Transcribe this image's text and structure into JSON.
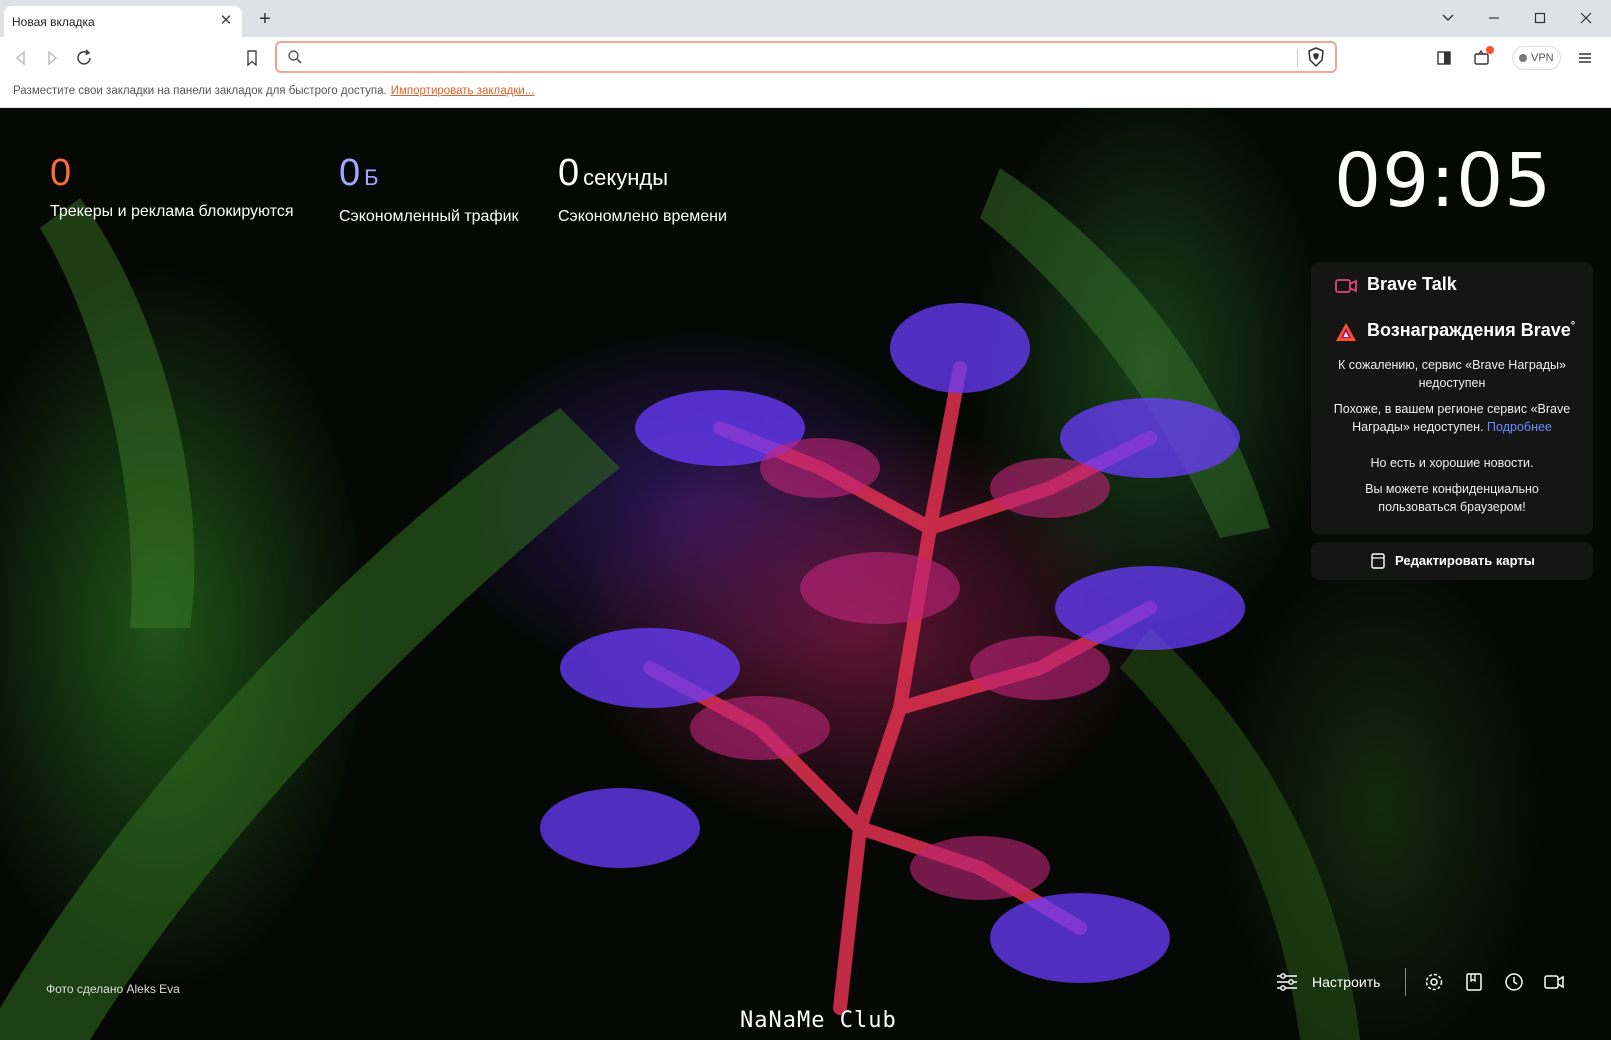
{
  "tab": {
    "title": "Новая вкладка",
    "close": "✕",
    "new_tab": "+"
  },
  "omnibox": {
    "value": "",
    "placeholder": ""
  },
  "toolbar": {
    "vpn_label": "VPN"
  },
  "bookmarks_bar": {
    "text": "Разместите свои закладки на панели закладок для быстрого доступа.",
    "import_link": "Импортировать закладки..."
  },
  "stats": [
    {
      "value": "0",
      "unit": "",
      "label": "Трекеры и реклама блокируются",
      "color": "#ff6b3d"
    },
    {
      "value": "0",
      "unit": "Б",
      "label": "Сэкономленный трафик",
      "color": "#a3a6ff"
    },
    {
      "value": "0",
      "unit": "секунды",
      "label": "Сэкономлено времени",
      "color": "#ffffff"
    }
  ],
  "clock": {
    "time": "09:05"
  },
  "cards": {
    "brave_talk": {
      "title": "Brave Talk"
    },
    "rewards": {
      "title": "Вознаграждения Brave",
      "title_sup": "°",
      "msg1": "К сожалению, сервис «Brave Награды» недоступен",
      "msg2": "Похоже, в вашем регионе сервис «Brave Награды» недоступен.",
      "more_link": "Подробнее",
      "msg3": "Но есть и хорошие новости.",
      "msg4": "Вы можете конфиденциально пользоваться браузером!"
    },
    "edit": {
      "label": "Редактировать карты"
    }
  },
  "footer": {
    "photo_credit": "Фото сделано Aleks Eva",
    "customize_label": "Настроить",
    "watermark": "NaNaMe Club"
  },
  "colors": {
    "accent": "#f0a58f",
    "link": "#d9612a",
    "rewards_link": "#6b8cff"
  }
}
